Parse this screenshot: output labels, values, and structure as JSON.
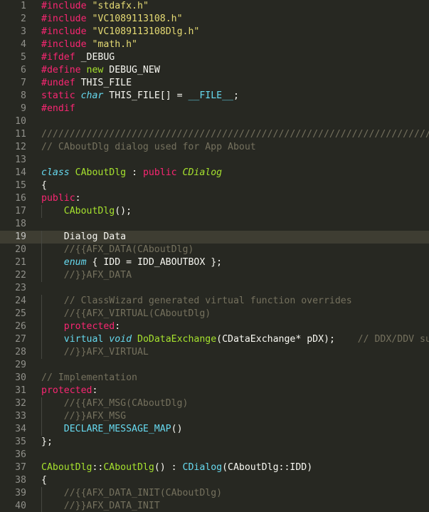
{
  "editor": {
    "theme_colors": {
      "background": "#272822",
      "active_line": "#3e3d32",
      "keyword": "#f92672",
      "string": "#e6db74",
      "comment": "#75715e",
      "type": "#66d9ef",
      "class": "#a6e22e",
      "text": "#f8f8f2"
    },
    "active_line": 19,
    "lines": [
      {
        "n": "1",
        "tokens": [
          [
            "#include",
            "k"
          ],
          [
            " ",
            ""
          ],
          [
            "\"stdafx.h\"",
            "s"
          ]
        ]
      },
      {
        "n": "2",
        "tokens": [
          [
            "#include",
            "k"
          ],
          [
            " ",
            ""
          ],
          [
            "\"VC1089113108.h\"",
            "s"
          ]
        ]
      },
      {
        "n": "3",
        "tokens": [
          [
            "#include",
            "k"
          ],
          [
            " ",
            ""
          ],
          [
            "\"VC1089113108Dlg.h\"",
            "s"
          ]
        ]
      },
      {
        "n": "4",
        "tokens": [
          [
            "#include",
            "k"
          ],
          [
            " ",
            ""
          ],
          [
            "\"math.h\"",
            "s"
          ]
        ]
      },
      {
        "n": "5",
        "tokens": [
          [
            "#ifdef",
            "k"
          ],
          [
            " _DEBUG",
            ""
          ]
        ]
      },
      {
        "n": "6",
        "tokens": [
          [
            "#define",
            "k"
          ],
          [
            " ",
            ""
          ],
          [
            "new",
            "g"
          ],
          [
            " DEBUG_NEW",
            ""
          ]
        ]
      },
      {
        "n": "7",
        "tokens": [
          [
            "#undef",
            "k"
          ],
          [
            " THIS_FILE",
            ""
          ]
        ]
      },
      {
        "n": "8",
        "tokens": [
          [
            "static",
            "k"
          ],
          [
            " ",
            ""
          ],
          [
            "char",
            "ti"
          ],
          [
            " THIS_FILE[] = ",
            ""
          ],
          [
            "__FILE__",
            "t"
          ],
          [
            ";",
            ""
          ]
        ]
      },
      {
        "n": "9",
        "tokens": [
          [
            "#endif",
            "k"
          ]
        ]
      },
      {
        "n": "10",
        "tokens": []
      },
      {
        "n": "11",
        "tokens": [
          [
            "///////////////////////////////////////////////////////////////////////////",
            "c"
          ]
        ]
      },
      {
        "n": "12",
        "tokens": [
          [
            "// CAboutDlg dialog used for App About",
            "c"
          ]
        ]
      },
      {
        "n": "13",
        "tokens": []
      },
      {
        "n": "14",
        "tokens": [
          [
            "class",
            "ti"
          ],
          [
            " ",
            ""
          ],
          [
            "CAboutDlg",
            "g"
          ],
          [
            " : ",
            ""
          ],
          [
            "public",
            "k"
          ],
          [
            " ",
            ""
          ],
          [
            "CDialog",
            "gi"
          ]
        ]
      },
      {
        "n": "15",
        "tokens": [
          [
            "{",
            ""
          ]
        ]
      },
      {
        "n": "16",
        "tokens": [
          [
            "public",
            "k"
          ],
          [
            ":",
            ""
          ]
        ]
      },
      {
        "n": "17",
        "tokens": [
          [
            "    ",
            ""
          ],
          [
            "CAboutDlg",
            "g"
          ],
          [
            "();",
            ""
          ]
        ]
      },
      {
        "n": "18",
        "tokens": []
      },
      {
        "n": "19",
        "tokens": [
          [
            "    Dialog Data",
            ""
          ]
        ]
      },
      {
        "n": "20",
        "tokens": [
          [
            "    ",
            ""
          ],
          [
            "//{{AFX_DATA(CAboutDlg)",
            "c"
          ]
        ]
      },
      {
        "n": "21",
        "tokens": [
          [
            "    ",
            ""
          ],
          [
            "enum",
            "ti"
          ],
          [
            " { IDD = IDD_ABOUTBOX };",
            ""
          ]
        ]
      },
      {
        "n": "22",
        "tokens": [
          [
            "    ",
            ""
          ],
          [
            "//}}AFX_DATA",
            "c"
          ]
        ]
      },
      {
        "n": "23",
        "tokens": []
      },
      {
        "n": "24",
        "tokens": [
          [
            "    ",
            ""
          ],
          [
            "// ClassWizard generated virtual function overrides",
            "c"
          ]
        ]
      },
      {
        "n": "25",
        "tokens": [
          [
            "    ",
            ""
          ],
          [
            "//{{AFX_VIRTUAL(CAboutDlg)",
            "c"
          ]
        ]
      },
      {
        "n": "26",
        "tokens": [
          [
            "    ",
            ""
          ],
          [
            "protected",
            "k"
          ],
          [
            ":",
            ""
          ]
        ]
      },
      {
        "n": "27",
        "tokens": [
          [
            "    ",
            ""
          ],
          [
            "virtual",
            "t"
          ],
          [
            " ",
            ""
          ],
          [
            "void",
            "ti"
          ],
          [
            " ",
            ""
          ],
          [
            "DoDataExchange",
            "g"
          ],
          [
            "(CDataExchange* pDX);    ",
            ""
          ],
          [
            "// DDX/DDV support",
            "c"
          ]
        ]
      },
      {
        "n": "28",
        "tokens": [
          [
            "    ",
            ""
          ],
          [
            "//}}AFX_VIRTUAL",
            "c"
          ]
        ]
      },
      {
        "n": "29",
        "tokens": []
      },
      {
        "n": "30",
        "tokens": [
          [
            "// Implementation",
            "c"
          ]
        ]
      },
      {
        "n": "31",
        "tokens": [
          [
            "protected",
            "k"
          ],
          [
            ":",
            ""
          ]
        ]
      },
      {
        "n": "32",
        "tokens": [
          [
            "    ",
            ""
          ],
          [
            "//{{AFX_MSG(CAboutDlg)",
            "c"
          ]
        ]
      },
      {
        "n": "33",
        "tokens": [
          [
            "    ",
            ""
          ],
          [
            "//}}AFX_MSG",
            "c"
          ]
        ]
      },
      {
        "n": "34",
        "tokens": [
          [
            "    ",
            ""
          ],
          [
            "DECLARE_MESSAGE_MAP",
            "t"
          ],
          [
            "()",
            ""
          ]
        ]
      },
      {
        "n": "35",
        "tokens": [
          [
            "};",
            ""
          ]
        ]
      },
      {
        "n": "36",
        "tokens": []
      },
      {
        "n": "37",
        "tokens": [
          [
            "CAboutDlg",
            "g"
          ],
          [
            "::",
            ""
          ],
          [
            "CAboutDlg",
            "g"
          ],
          [
            "() : ",
            ""
          ],
          [
            "CDialog",
            "t"
          ],
          [
            "(CAboutDlg::IDD)",
            ""
          ]
        ]
      },
      {
        "n": "38",
        "tokens": [
          [
            "{",
            ""
          ]
        ]
      },
      {
        "n": "39",
        "tokens": [
          [
            "    ",
            ""
          ],
          [
            "//{{AFX_DATA_INIT(CAboutDlg)",
            "c"
          ]
        ]
      },
      {
        "n": "40",
        "tokens": [
          [
            "    ",
            ""
          ],
          [
            "//}}AFX_DATA_INIT",
            "c"
          ]
        ]
      }
    ]
  }
}
